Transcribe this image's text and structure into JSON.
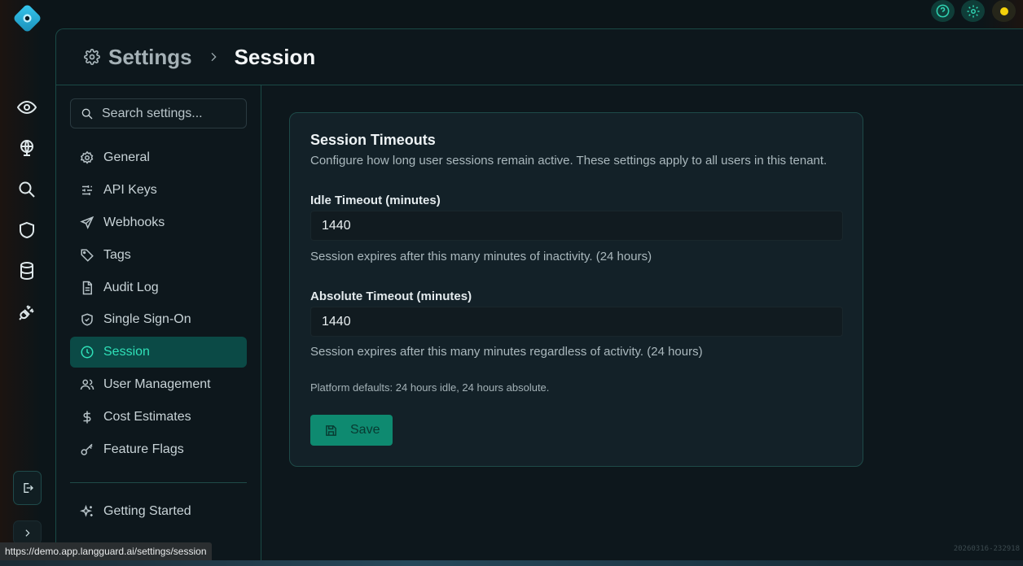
{
  "header": {
    "breadcrumb_parent": "Settings",
    "breadcrumb_current": "Session"
  },
  "rail": {
    "icons": [
      "eye-icon",
      "globe-icon",
      "search-icon",
      "shield-icon",
      "database-icon",
      "plug-icon"
    ]
  },
  "sidebar": {
    "search_placeholder": "Search settings...",
    "items": [
      {
        "label": "General",
        "icon": "gear-icon"
      },
      {
        "label": "API Keys",
        "icon": "sliders-icon"
      },
      {
        "label": "Webhooks",
        "icon": "send-icon"
      },
      {
        "label": "Tags",
        "icon": "tag-icon"
      },
      {
        "label": "Audit Log",
        "icon": "document-icon"
      },
      {
        "label": "Single Sign-On",
        "icon": "shield-check-icon"
      },
      {
        "label": "Session",
        "icon": "clock-icon",
        "active": true
      },
      {
        "label": "User Management",
        "icon": "users-icon"
      },
      {
        "label": "Cost Estimates",
        "icon": "dollar-icon"
      },
      {
        "label": "Feature Flags",
        "icon": "key-icon"
      }
    ],
    "footer_label": "Getting Started"
  },
  "card": {
    "title": "Session Timeouts",
    "description": "Configure how long user sessions remain active. These settings apply to all users in this tenant.",
    "idle": {
      "label": "Idle Timeout (minutes)",
      "value": "1440",
      "help": "Session expires after this many minutes of inactivity. (24 hours)"
    },
    "absolute": {
      "label": "Absolute Timeout (minutes)",
      "value": "1440",
      "help": "Session expires after this many minutes regardless of activity. (24 hours)"
    },
    "defaults_note": "Platform defaults: 24 hours idle, 24 hours absolute.",
    "save_label": "Save"
  },
  "status": {
    "url": "https://demo.app.langguard.ai/settings/session",
    "version": "20260316-232918"
  },
  "colors": {
    "accent": "#2fe0b8",
    "active_bg": "#0b4a46",
    "save_bg": "#0e8a70",
    "border": "#1a4a46"
  }
}
